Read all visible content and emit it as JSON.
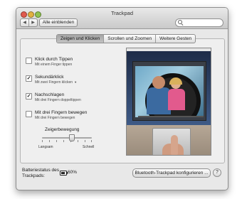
{
  "window": {
    "title": "Trackpad",
    "nav_back": "◀",
    "nav_forward": "▶",
    "show_all_label": "Alle einblenden",
    "search_placeholder": ""
  },
  "tabs": [
    {
      "label": "Zeigen und Klicken",
      "active": true
    },
    {
      "label": "Scrollen und Zoomen",
      "active": false
    },
    {
      "label": "Weitere Gesten",
      "active": false
    }
  ],
  "options": [
    {
      "title": "Klick durch Tippen",
      "subtitle": "Mit einem Finger tippen",
      "checked": false
    },
    {
      "title": "Sekundärklick",
      "subtitle": "Mit zwei Fingern klicken",
      "checked": true,
      "has_dropdown": true
    },
    {
      "title": "Nachschlagen",
      "subtitle": "Mit drei Fingern doppeltippen",
      "checked": true
    },
    {
      "title": "Mit drei Fingern bewegen",
      "subtitle": "Mit drei Fingern bewegen",
      "checked": false
    }
  ],
  "tracking_speed": {
    "label": "Zeigerbewegung",
    "min_label": "Langsam",
    "max_label": "Schnell",
    "value_fraction": 0.55
  },
  "battery": {
    "label": "Batteriestatus des Trackpads:",
    "value": "60%"
  },
  "bluetooth_button_label": "Bluetooth-Trackpad konfigurieren ...",
  "help_label": "?",
  "colors": {
    "close": "#e0594e",
    "minimize": "#e2b140",
    "maximize": "#8fc24f"
  }
}
